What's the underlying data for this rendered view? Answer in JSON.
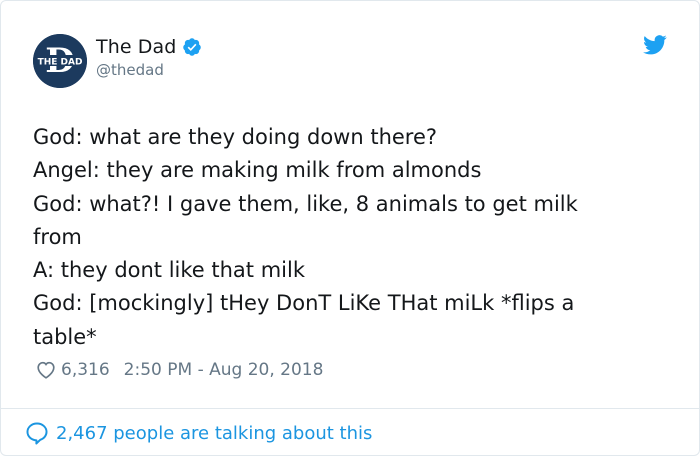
{
  "tweet": {
    "author": {
      "display_name": "The Dad",
      "handle": "@thedad",
      "verified": true,
      "avatar_logo_text": "THE DAD",
      "avatar_letter": "D"
    },
    "lines": [
      "God: what are they doing down there?",
      "Angel: they are making milk from almonds",
      "God: what?! I gave them, like, 8 animals to get milk",
      "from",
      "A: they dont like that milk",
      "God: [mockingly] tHey DonT LiKe THat miLk *flips a",
      "table*"
    ],
    "likes": "6,316",
    "timestamp": "2:50 PM - Aug 20, 2018",
    "talking_text": "2,467 people are talking about this"
  },
  "icons": {
    "verified": "verified-badge-icon",
    "bird": "twitter-bird-icon",
    "heart": "heart-outline-icon",
    "bubble": "speech-bubble-icon"
  },
  "colors": {
    "text": "#14171a",
    "muted": "#657786",
    "accent": "#1b95e0",
    "avatar_bg": "#1c3a5e",
    "border": "#e1e8ed"
  }
}
